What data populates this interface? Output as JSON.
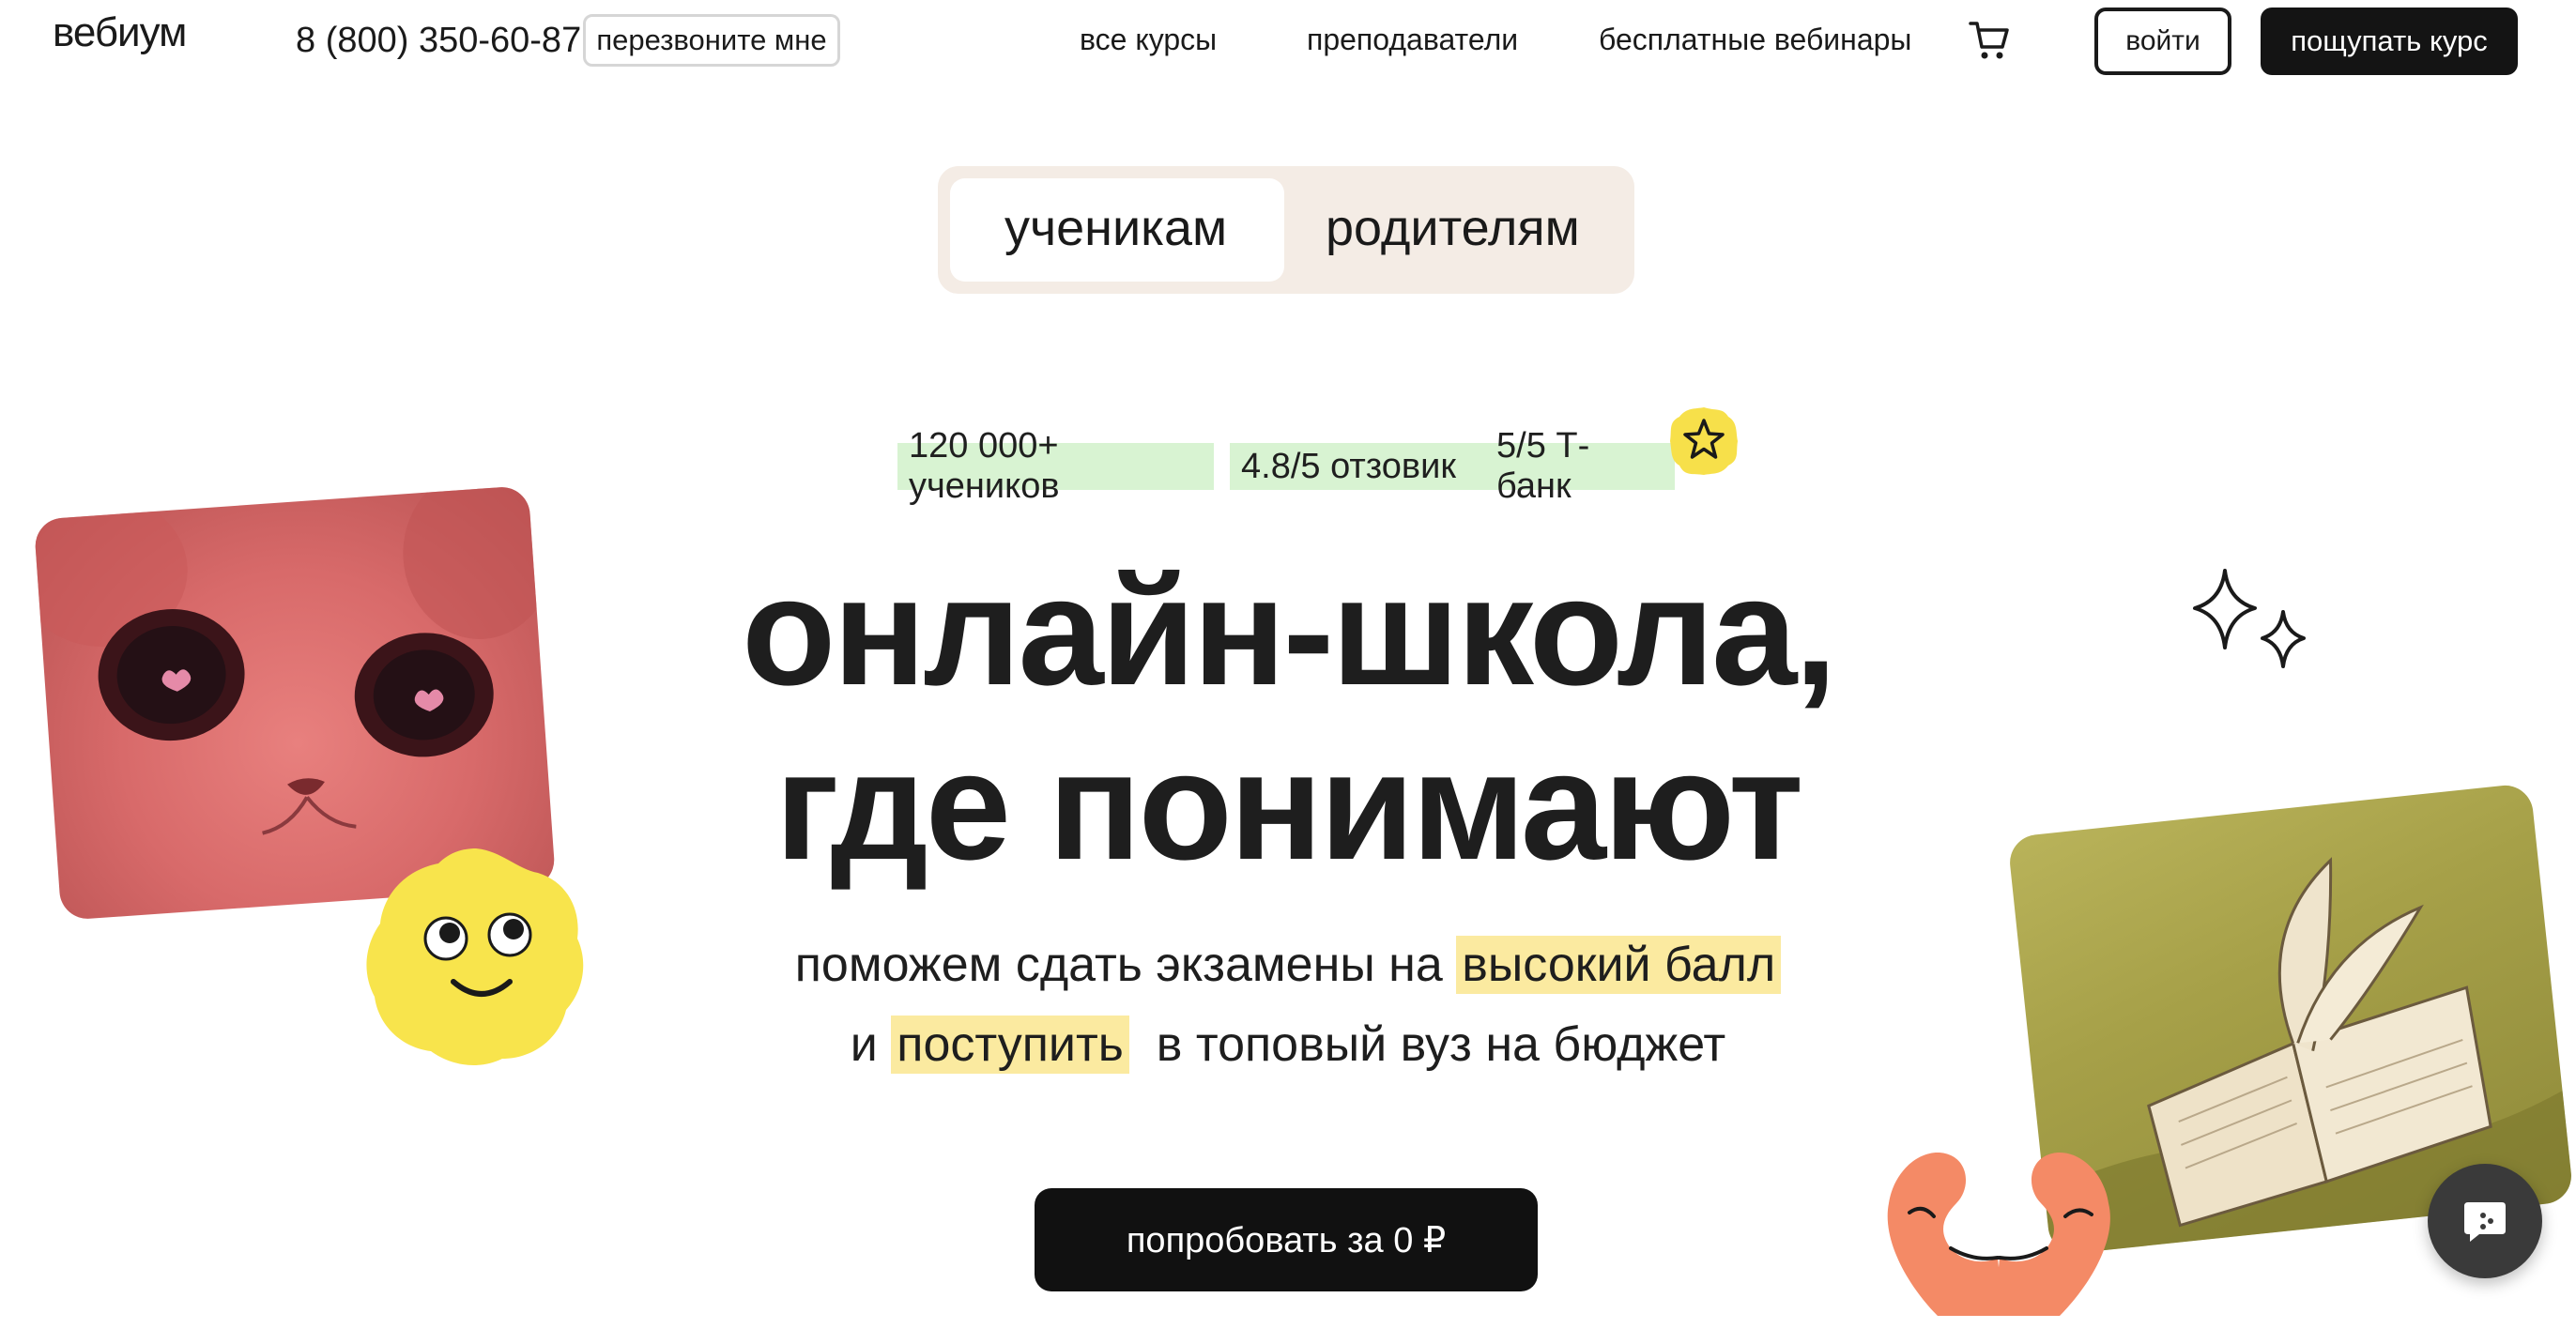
{
  "header": {
    "logo": "вебиум",
    "phone": "8 (800) 350-60-87",
    "callback_label": "перезвоните мне",
    "nav": [
      "все курсы",
      "преподаватели",
      "бесплатные вебинары"
    ],
    "cart_icon": "cart-icon",
    "login_label": "войти",
    "try_course_label": "пощупать курс"
  },
  "audience_switch": {
    "tabs": [
      "ученикам",
      "родителям"
    ],
    "active": "ученикам"
  },
  "stats": {
    "badges": [
      "120 000+ учеников",
      "4.8/5 отзовик",
      "5/5 Т-банк"
    ],
    "badge_color": "#d8f3d2"
  },
  "hero": {
    "headline_line1": "онлайн-школа,",
    "headline_line2": "где понимают",
    "sub_line1_prefix": "поможем сдать экзамены на ",
    "sub_line1_highlight": "высокий балл",
    "sub_line2_prefix": "и ",
    "sub_line2_highlight": "поступить",
    "sub_line2_suffix": "  в топовый вуз на бюджет",
    "highlight_color": "#fbeaa0",
    "cta_label": "попробовать за 0 ₽"
  },
  "decorations": {
    "icons": [
      "cat-photo",
      "smiley-blob-icon",
      "star-badge-icon",
      "sparkles-icon",
      "book-photo",
      "heart-hands-icon",
      "chat-icon"
    ]
  }
}
